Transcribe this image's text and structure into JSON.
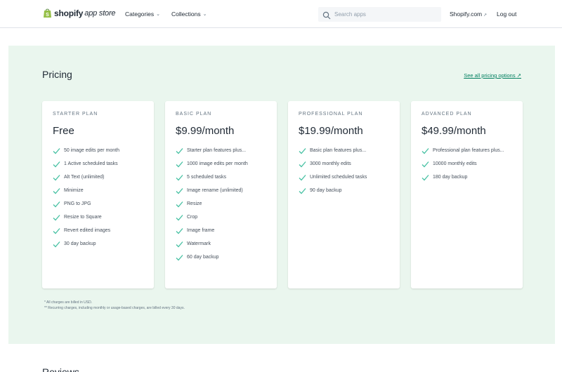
{
  "header": {
    "logo_word": "shopify",
    "logo_sub": "app store",
    "nav": [
      {
        "label": "Categories"
      },
      {
        "label": "Collections"
      }
    ],
    "search_placeholder": "Search apps",
    "shopify_link": "Shopify.com",
    "logout": "Log out"
  },
  "pricing": {
    "title": "Pricing",
    "see_all": "See all pricing options",
    "plans": [
      {
        "name": "STARTER PLAN",
        "price": "Free",
        "features": [
          "50 image edits per month",
          "1 Active scheduled tasks",
          "Alt Text (unlimited)",
          "Minimize",
          "PNG to JPG",
          "Resize to Square",
          "Revert edited images",
          "30 day backup"
        ]
      },
      {
        "name": "BASIC PLAN",
        "price": "$9.99/month",
        "features": [
          "Starter plan features plus...",
          "1000 image edits per month",
          "5 scheduled tasks",
          "Image rename (unlimited)",
          "Resize",
          "Crop",
          "Image frame",
          "Watermark",
          "60 day backup"
        ]
      },
      {
        "name": "PROFESSIONAL PLAN",
        "price": "$19.99/month",
        "features": [
          "Basic plan features plus...",
          "3000 monthly edits",
          "Unlimited scheduled tasks",
          "90 day backup"
        ]
      },
      {
        "name": "ADVANCED PLAN",
        "price": "$49.99/month",
        "features": [
          "Professional plan features plus...",
          "10000 monthly edits",
          "180 day backup"
        ]
      }
    ],
    "footnote_1": "* All charges are billed in USD.",
    "footnote_2": "** Recurring charges, including monthly or usage-based charges, are billed every 30 days."
  },
  "next_section_title": "Reviews",
  "colors": {
    "accent": "#008060",
    "section_bg": "#eaf6ee"
  }
}
